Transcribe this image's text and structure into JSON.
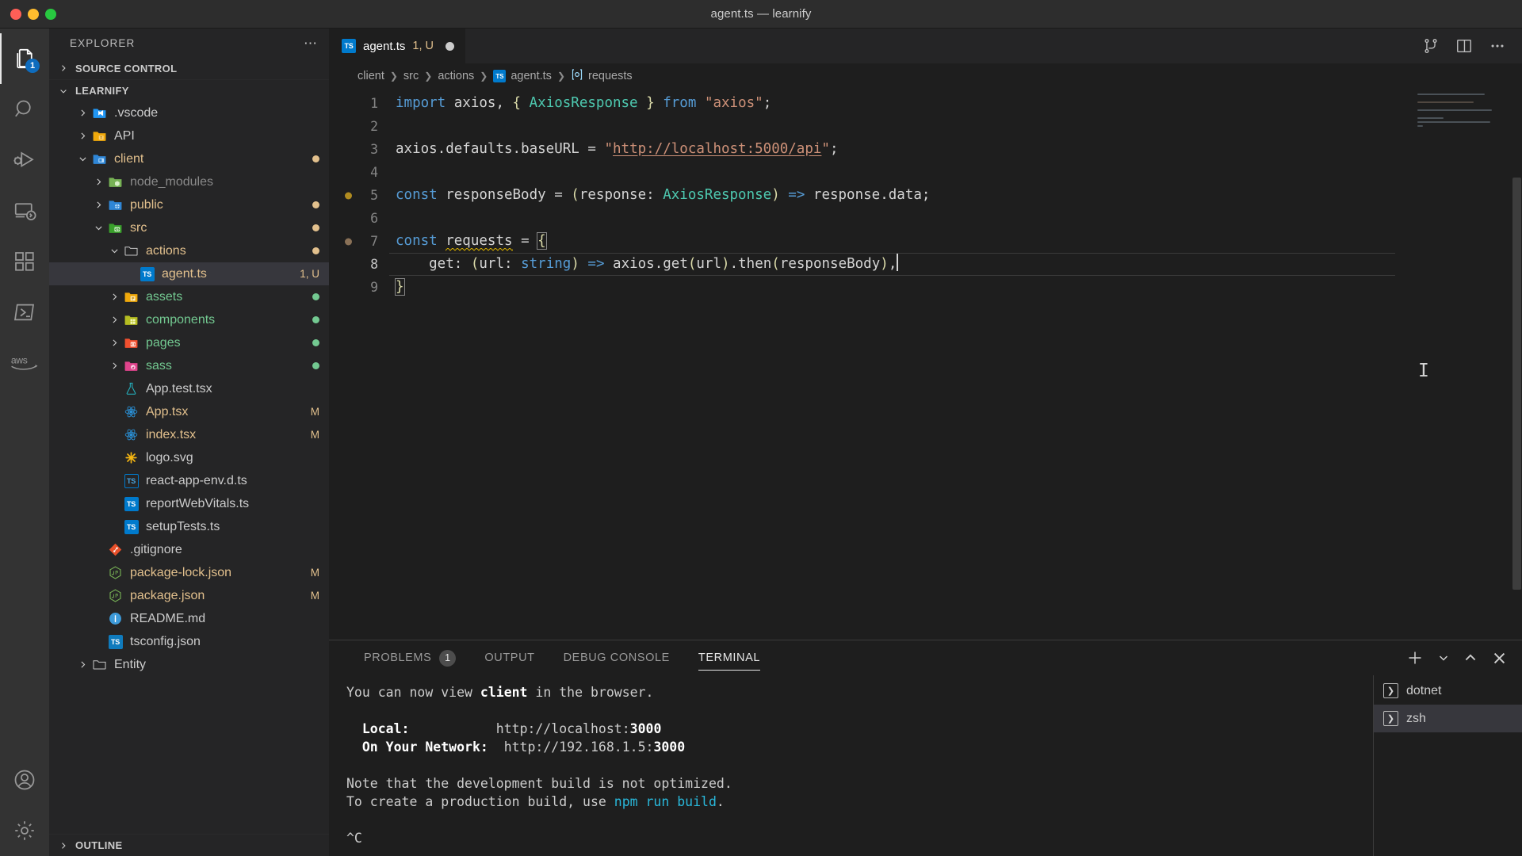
{
  "window": {
    "title": "agent.ts — learnify",
    "traffic_lights": [
      "close",
      "minimize",
      "maximize"
    ]
  },
  "activity_bar": {
    "items": [
      {
        "name": "explorer",
        "icon": "files-icon",
        "badge": "1",
        "active": true
      },
      {
        "name": "search",
        "icon": "search-icon",
        "badge": "",
        "active": false
      },
      {
        "name": "run-and-debug",
        "icon": "run-debug-icon",
        "badge": "",
        "active": false
      },
      {
        "name": "remote-explorer",
        "icon": "remote-icon",
        "badge": "",
        "active": false
      },
      {
        "name": "extensions",
        "icon": "extensions-icon",
        "badge": "",
        "active": false
      },
      {
        "name": "powershell",
        "icon": "terminal-powershell-icon",
        "badge": "",
        "active": false
      },
      {
        "name": "aws-toolkit",
        "icon": "aws-icon",
        "badge": "",
        "active": false
      }
    ],
    "bottom_items": [
      {
        "name": "accounts",
        "icon": "account-icon"
      },
      {
        "name": "manage",
        "icon": "gear-icon"
      }
    ]
  },
  "sidebar": {
    "header_title": "EXPLORER",
    "more_actions": "⋯",
    "sections": [
      {
        "label": "SOURCE CONTROL",
        "expanded": false
      },
      {
        "label": "LEARNIFY",
        "expanded": true
      }
    ],
    "tree": [
      {
        "label": ".vscode",
        "indent": 1,
        "type": "folder",
        "twisty": "collapsed",
        "icon": "folder-vscode-icon",
        "color": "#cccccc",
        "deco": ""
      },
      {
        "label": "API",
        "indent": 1,
        "type": "folder",
        "twisty": "collapsed",
        "icon": "folder-api-icon",
        "color": "#cccccc",
        "deco": ""
      },
      {
        "label": "client",
        "indent": 1,
        "type": "folder",
        "twisty": "expanded",
        "icon": "folder-client-icon",
        "color": "#e2c08d",
        "deco": "dot-amber"
      },
      {
        "label": "node_modules",
        "indent": 2,
        "type": "folder",
        "twisty": "collapsed",
        "icon": "folder-node-icon",
        "color": "#8a8a8a",
        "deco": ""
      },
      {
        "label": "public",
        "indent": 2,
        "type": "folder",
        "twisty": "collapsed",
        "icon": "folder-public-icon",
        "color": "#e2c08d",
        "deco": "dot-amber"
      },
      {
        "label": "src",
        "indent": 2,
        "type": "folder",
        "twisty": "expanded",
        "icon": "folder-src-icon",
        "color": "#e2c08d",
        "deco": "dot-amber"
      },
      {
        "label": "actions",
        "indent": 3,
        "type": "folder",
        "twisty": "expanded",
        "icon": "folder-icon",
        "color": "#e2c08d",
        "deco": "dot-amber"
      },
      {
        "label": "agent.ts",
        "indent": 4,
        "type": "file",
        "twisty": "none",
        "icon": "typescript-icon",
        "color": "#e2c08d",
        "deco": "1, U",
        "selected": true
      },
      {
        "label": "assets",
        "indent": 3,
        "type": "folder",
        "twisty": "collapsed",
        "icon": "folder-assets-icon",
        "color": "#73c991",
        "deco": "dot-green"
      },
      {
        "label": "components",
        "indent": 3,
        "type": "folder",
        "twisty": "collapsed",
        "icon": "folder-components-icon",
        "color": "#73c991",
        "deco": "dot-green"
      },
      {
        "label": "pages",
        "indent": 3,
        "type": "folder",
        "twisty": "collapsed",
        "icon": "folder-pages-icon",
        "color": "#73c991",
        "deco": "dot-green"
      },
      {
        "label": "sass",
        "indent": 3,
        "type": "folder",
        "twisty": "collapsed",
        "icon": "folder-sass-icon",
        "color": "#73c991",
        "deco": "dot-green"
      },
      {
        "label": "App.test.tsx",
        "indent": 3,
        "type": "file",
        "twisty": "none",
        "icon": "test-flask-icon",
        "color": "#cccccc",
        "deco": ""
      },
      {
        "label": "App.tsx",
        "indent": 3,
        "type": "file",
        "twisty": "none",
        "icon": "react-icon",
        "color": "#e2c08d",
        "deco": "M"
      },
      {
        "label": "index.tsx",
        "indent": 3,
        "type": "file",
        "twisty": "none",
        "icon": "react-icon",
        "color": "#e2c08d",
        "deco": "M"
      },
      {
        "label": "logo.svg",
        "indent": 3,
        "type": "file",
        "twisty": "none",
        "icon": "svg-icon",
        "color": "#cccccc",
        "deco": ""
      },
      {
        "label": "react-app-env.d.ts",
        "indent": 3,
        "type": "file",
        "twisty": "none",
        "icon": "typescript-def-icon",
        "color": "#cccccc",
        "deco": ""
      },
      {
        "label": "reportWebVitals.ts",
        "indent": 3,
        "type": "file",
        "twisty": "none",
        "icon": "typescript-icon",
        "color": "#cccccc",
        "deco": ""
      },
      {
        "label": "setupTests.ts",
        "indent": 3,
        "type": "file",
        "twisty": "none",
        "icon": "typescript-icon",
        "color": "#cccccc",
        "deco": ""
      },
      {
        "label": ".gitignore",
        "indent": 2,
        "type": "file",
        "twisty": "none",
        "icon": "git-icon",
        "color": "#cccccc",
        "deco": ""
      },
      {
        "label": "package-lock.json",
        "indent": 2,
        "type": "file",
        "twisty": "none",
        "icon": "npm-json-icon",
        "color": "#e2c08d",
        "deco": "M"
      },
      {
        "label": "package.json",
        "indent": 2,
        "type": "file",
        "twisty": "none",
        "icon": "npm-json-icon",
        "color": "#e2c08d",
        "deco": "M"
      },
      {
        "label": "README.md",
        "indent": 2,
        "type": "file",
        "twisty": "none",
        "icon": "info-markdown-icon",
        "color": "#cccccc",
        "deco": ""
      },
      {
        "label": "tsconfig.json",
        "indent": 2,
        "type": "file",
        "twisty": "none",
        "icon": "typescript-config-icon",
        "color": "#cccccc",
        "deco": ""
      },
      {
        "label": "Entity",
        "indent": 1,
        "type": "folder",
        "twisty": "collapsed",
        "icon": "folder-plain-icon",
        "color": "#cccccc",
        "deco": ""
      }
    ],
    "outline_label": "OUTLINE"
  },
  "editor": {
    "tab": {
      "label": "agent.ts",
      "decoration": "1, U",
      "icon": "typescript-icon",
      "dirty": true
    },
    "tab_actions": [
      "split-editor-vertical-icon",
      "source-control-graph-icon",
      "more-actions-icon"
    ],
    "breadcrumb": [
      {
        "label": "client",
        "icon": ""
      },
      {
        "label": "src",
        "icon": ""
      },
      {
        "label": "actions",
        "icon": ""
      },
      {
        "label": "agent.ts",
        "icon": "typescript-icon"
      },
      {
        "label": "requests",
        "icon": "symbol-object-icon"
      }
    ],
    "lines": [
      {
        "n": "1",
        "marker": ""
      },
      {
        "n": "2",
        "marker": ""
      },
      {
        "n": "3",
        "marker": ""
      },
      {
        "n": "4",
        "marker": ""
      },
      {
        "n": "5",
        "marker": "amber"
      },
      {
        "n": "6",
        "marker": ""
      },
      {
        "n": "7",
        "marker": "brown"
      },
      {
        "n": "8",
        "marker": ""
      },
      {
        "n": "9",
        "marker": ""
      }
    ],
    "code": {
      "l1": "import axios, { AxiosResponse } from \"axios\";",
      "l3": "axios.defaults.baseURL = \"http://localhost:5000/api\";",
      "l5": "const responseBody = (response: AxiosResponse) => response.data;",
      "l7": "const requests = {",
      "l8": "    get: (url: string) => axios.get(url).then(responseBody),",
      "l9": "}",
      "tokens": {
        "import": "import",
        "axios_ident": "axios,",
        "brace_open": "{",
        "axios_response": "AxiosResponse",
        "brace_close": "}",
        "from": "from",
        "axios_str": "\"axios\"",
        "axios_defaults": "axios.defaults.baseURL",
        "eq": "=",
        "base_url_str": "\"http://localhost:5000/api\"",
        "const": "const",
        "response_body": "responseBody",
        "paren_open": "(",
        "response": "response:",
        "paren_close": ")",
        "fat_arrow": "=>",
        "response_data": "response.data;",
        "requests": "requests",
        "get": "get:",
        "url": "url:",
        "string_type": "string",
        "axios_get": "axios.get",
        "url_arg": "url",
        "then": ".then",
        "responsebody_arg": "responseBody",
        "comma": "),"
      }
    },
    "colors": {
      "keyword": "#569cd6",
      "string": "#ce9178",
      "type": "#4ec9b0",
      "variable": "#9cdcfe",
      "yellow": "#dcdcaa",
      "default": "#d4d4d4",
      "warning_squiggle": "#cca700"
    }
  },
  "panel": {
    "tabs": [
      {
        "label": "PROBLEMS",
        "badge": "1",
        "active": false
      },
      {
        "label": "OUTPUT",
        "badge": "",
        "active": false
      },
      {
        "label": "DEBUG CONSOLE",
        "badge": "",
        "active": false
      },
      {
        "label": "TERMINAL",
        "badge": "",
        "active": true
      }
    ],
    "actions": [
      "new-terminal-icon",
      "chevron-down-icon",
      "maximize-panel-icon",
      "close-panel-icon"
    ],
    "terminal_output": {
      "line1_pre": "You can now view ",
      "line1_bold": "client",
      "line1_post": " in the browser.",
      "local_label": "  Local:",
      "local_url_pre": "http://localhost:",
      "local_port": "3000",
      "network_label": "  On Your Network:",
      "network_url_pre": "http://192.168.1.5:",
      "network_port": "3000",
      "note1": "Note that the development build is not optimized.",
      "note2_pre": "To create a production build, use ",
      "note2_cmd": "npm run build",
      "note2_post": ".",
      "interrupt": "^C"
    },
    "terminal_instances": [
      {
        "label": "dotnet",
        "icon": "terminal-chevron-icon",
        "active": false
      },
      {
        "label": "zsh",
        "icon": "terminal-chevron-icon",
        "active": true
      }
    ]
  }
}
